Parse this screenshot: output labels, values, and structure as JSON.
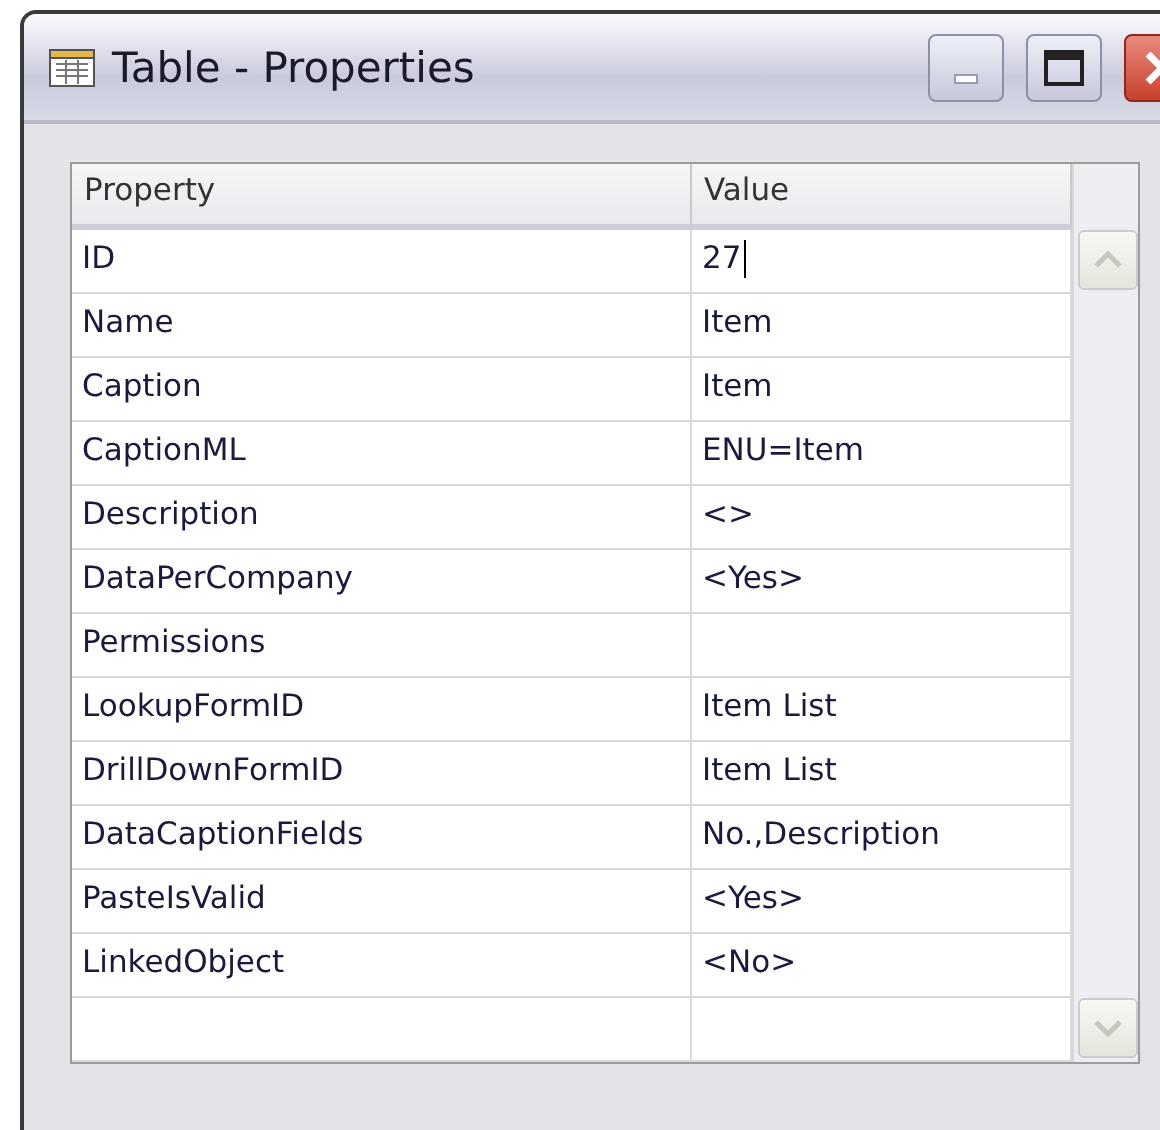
{
  "window": {
    "title": "Table - Properties"
  },
  "table": {
    "columns": [
      "Property",
      "Value"
    ],
    "rows": [
      {
        "property": "ID",
        "value": "27",
        "editing": true
      },
      {
        "property": "Name",
        "value": "Item",
        "editing": false
      },
      {
        "property": "Caption",
        "value": "Item",
        "editing": false
      },
      {
        "property": "CaptionML",
        "value": "ENU=Item",
        "editing": false
      },
      {
        "property": "Description",
        "value": "<>",
        "editing": false
      },
      {
        "property": "DataPerCompany",
        "value": "<Yes>",
        "editing": false
      },
      {
        "property": "Permissions",
        "value": "",
        "editing": false
      },
      {
        "property": "LookupFormID",
        "value": "Item List",
        "editing": false
      },
      {
        "property": "DrillDownFormID",
        "value": "Item List",
        "editing": false
      },
      {
        "property": "DataCaptionFields",
        "value": "No.,Description",
        "editing": false
      },
      {
        "property": "PasteIsValid",
        "value": "<Yes>",
        "editing": false
      },
      {
        "property": "LinkedObject",
        "value": "<No>",
        "editing": false
      }
    ]
  }
}
